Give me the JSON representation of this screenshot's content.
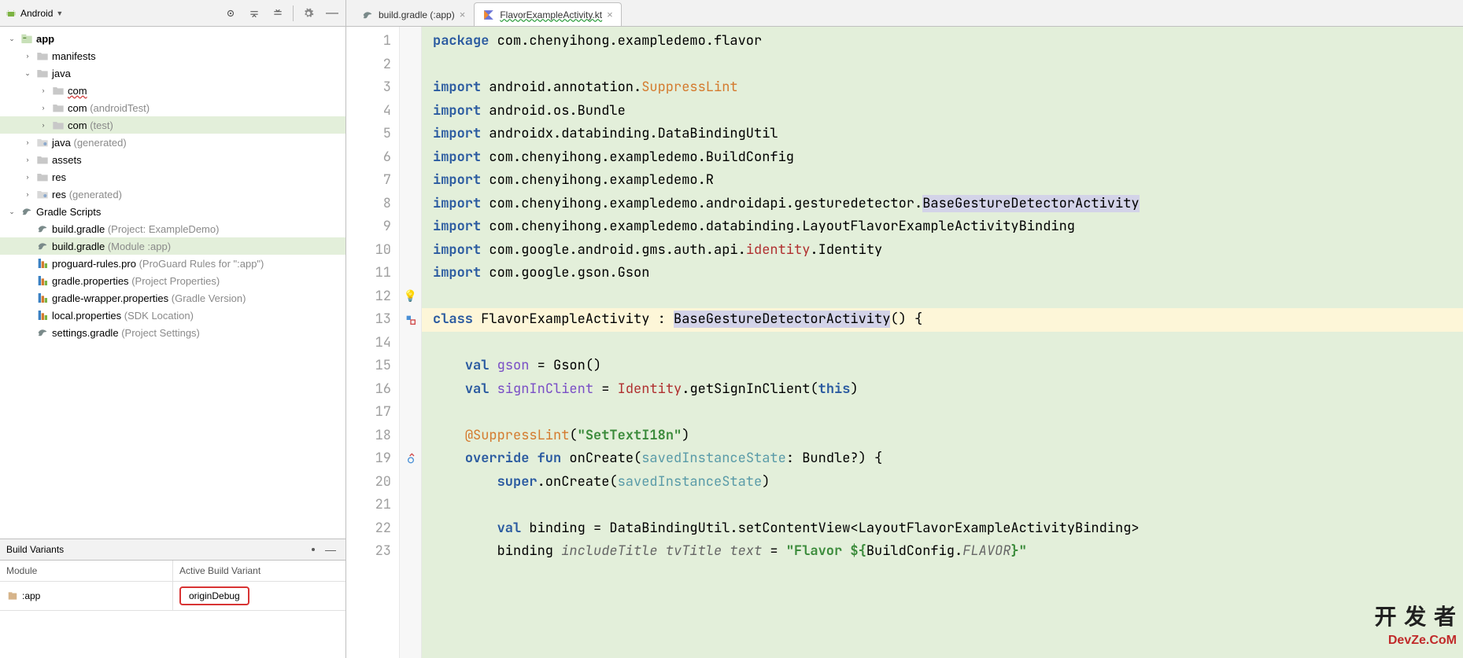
{
  "toolbar": {
    "view_label": "Android"
  },
  "tree": [
    {
      "depth": 0,
      "exp": "v",
      "icon": "module",
      "label": "app",
      "bold": true
    },
    {
      "depth": 1,
      "exp": ">",
      "icon": "folder",
      "label": "manifests"
    },
    {
      "depth": 1,
      "exp": "v",
      "icon": "folder",
      "label": "java"
    },
    {
      "depth": 2,
      "exp": ">",
      "icon": "folder",
      "label": "com",
      "error": true
    },
    {
      "depth": 2,
      "exp": ">",
      "icon": "folder",
      "label": "com",
      "suffix": "(androidTest)"
    },
    {
      "depth": 2,
      "exp": ">",
      "icon": "folder",
      "label": "com",
      "suffix": "(test)",
      "selected": true
    },
    {
      "depth": 1,
      "exp": ">",
      "icon": "folder-gen",
      "label": "java",
      "suffix": "(generated)"
    },
    {
      "depth": 1,
      "exp": ">",
      "icon": "folder",
      "label": "assets"
    },
    {
      "depth": 1,
      "exp": ">",
      "icon": "folder",
      "label": "res"
    },
    {
      "depth": 1,
      "exp": ">",
      "icon": "folder-gen",
      "label": "res",
      "suffix": "(generated)"
    },
    {
      "depth": 0,
      "exp": "v",
      "icon": "gradle",
      "label": "Gradle Scripts"
    },
    {
      "depth": 1,
      "exp": "",
      "icon": "gradle",
      "label": "build.gradle",
      "suffix": "(Project: ExampleDemo)"
    },
    {
      "depth": 1,
      "exp": "",
      "icon": "gradle",
      "label": "build.gradle",
      "suffix": "(Module :app)",
      "selected": true
    },
    {
      "depth": 1,
      "exp": "",
      "icon": "props",
      "label": "proguard-rules.pro",
      "suffix": "(ProGuard Rules for \":app\")"
    },
    {
      "depth": 1,
      "exp": "",
      "icon": "props",
      "label": "gradle.properties",
      "suffix": "(Project Properties)"
    },
    {
      "depth": 1,
      "exp": "",
      "icon": "props",
      "label": "gradle-wrapper.properties",
      "suffix": "(Gradle Version)"
    },
    {
      "depth": 1,
      "exp": "",
      "icon": "props",
      "label": "local.properties",
      "suffix": "(SDK Location)"
    },
    {
      "depth": 1,
      "exp": "",
      "icon": "gradle",
      "label": "settings.gradle",
      "suffix": "(Project Settings)"
    }
  ],
  "build_variants": {
    "title": "Build Variants",
    "col_module": "Module",
    "col_variant": "Active Build Variant",
    "rows": [
      {
        "module": ":app",
        "variant": "originDebug"
      }
    ]
  },
  "tabs": [
    {
      "icon": "gradle",
      "label": "build.gradle (:app)",
      "active": false
    },
    {
      "icon": "kotlin",
      "label": "FlavorExampleActivity.kt",
      "active": true,
      "wavy": true
    }
  ],
  "code": {
    "lines": [
      {
        "n": 1,
        "html": "<span class='kw'>package</span> com.chenyihong.exampledemo.flavor"
      },
      {
        "n": 2,
        "html": ""
      },
      {
        "n": 3,
        "html": "<span class='kw'>import</span> android.annotation.<span class='clr-orange'>SuppressLint</span>"
      },
      {
        "n": 4,
        "html": "<span class='kw'>import</span> android.os.Bundle"
      },
      {
        "n": 5,
        "html": "<span class='kw'>import</span> androidx.databinding.DataBindingUtil"
      },
      {
        "n": 6,
        "html": "<span class='kw'>import</span> com.chenyihong.exampledemo.BuildConfig"
      },
      {
        "n": 7,
        "html": "<span class='kw'>import</span> com.chenyihong.exampledemo.R"
      },
      {
        "n": 8,
        "html": "<span class='kw'>import</span> com.chenyihong.exampledemo.androidapi.gesturedetector.<span class='box-sel'>BaseGestureDetectorActivity</span>"
      },
      {
        "n": 9,
        "html": "<span class='kw'>import</span> com.chenyihong.exampledemo.databinding.LayoutFlavorExampleActivityBinding"
      },
      {
        "n": 10,
        "html": "<span class='kw'>import</span> com.google.android.gms.auth.api.<span class='clr-red'>identity</span>.Identity"
      },
      {
        "n": 11,
        "html": "<span class='kw'>import</span> com.google.gson.Gson"
      },
      {
        "n": 12,
        "html": "",
        "annot": "bulb"
      },
      {
        "n": 13,
        "html": "<span class='kw'>class</span> FlavorExampleActivity : <span class='box-sel'>BaseGestureDetectorActivity</span>() {",
        "yellow": true,
        "annot": "impl"
      },
      {
        "n": 14,
        "html": ""
      },
      {
        "n": 15,
        "html": "    <span class='kw'>val</span> <span class='clr-purple'>gson</span> = Gson()"
      },
      {
        "n": 16,
        "html": "    <span class='kw'>val</span> <span class='clr-purple'>signInClient</span> = <span class='clr-red'>Identity</span>.getSignInClient(<span class='kw'>this</span>)"
      },
      {
        "n": 17,
        "html": ""
      },
      {
        "n": 18,
        "html": "    <span class='clr-orange'>@SuppressLint</span>(<span class='clr-str'>\"SetTextI18n\"</span>)"
      },
      {
        "n": 19,
        "html": "    <span class='kw'>override fun</span> onCreate(<span class='clr-param'>savedInstanceState</span>: Bundle?) {",
        "annot": "override"
      },
      {
        "n": 20,
        "html": "        <span class='kw'>super</span>.onCreate(<span class='clr-param'>savedInstanceState</span>)"
      },
      {
        "n": 21,
        "html": ""
      },
      {
        "n": 22,
        "html": "        <span class='kw'>val</span> binding = DataBindingUtil.setContentView&lt;LayoutFlavorExampleActivityBinding&gt;"
      },
      {
        "n": 23,
        "html": "        binding <span class='ital'>includeTitle tvTitle text</span> = <span class='clr-str'>\"Flavor ${</span>BuildConfig.<span class='clr-purple ital'>FLAVOR</span><span class='clr-str'>}\"</span>"
      }
    ]
  },
  "watermark": {
    "line1": "开 发 者",
    "line2": "DevZe.CoM"
  }
}
